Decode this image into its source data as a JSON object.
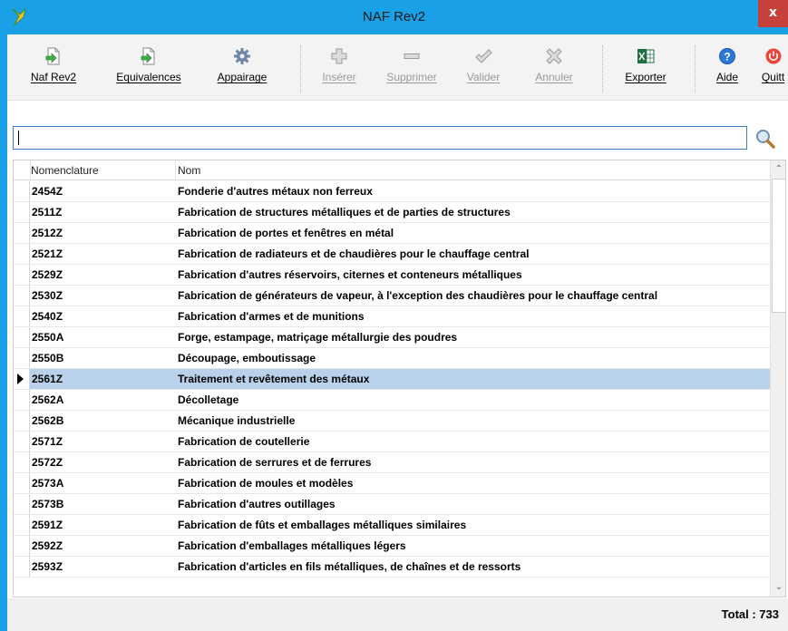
{
  "window": {
    "title": "NAF Rev2",
    "close_glyph": "x"
  },
  "icons": {
    "app": "app-logo-icon",
    "naf": "document-green-arrow-icon",
    "equivalences": "document-green-arrow-icon",
    "appairage": "gear-icon",
    "inserer": "plus-icon",
    "supprimer": "minus-icon",
    "valider": "checkmark-icon",
    "annuler": "cross-icon",
    "exporter": "excel-icon",
    "aide": "help-icon",
    "quitter": "power-icon",
    "search": "magnifier-icon"
  },
  "toolbar": {
    "naf_label": "Naf Rev2",
    "equivalences_label": "Equivalences",
    "appairage_label": "Appairage",
    "inserer_label": "Insérer",
    "supprimer_label": "Supprimer",
    "valider_label": "Valider",
    "annuler_label": "Annuler",
    "exporter_label": "Exporter",
    "aide_label": "Aide",
    "quitter_label": "Quitt"
  },
  "search": {
    "value": "",
    "placeholder": ""
  },
  "grid": {
    "columns": [
      "Nomenclature",
      "Nom"
    ],
    "selected_index": 9,
    "rows": [
      {
        "code": "2454Z",
        "nom": "Fonderie d'autres métaux non ferreux"
      },
      {
        "code": "2511Z",
        "nom": "Fabrication de structures métalliques et de parties de structures"
      },
      {
        "code": "2512Z",
        "nom": "Fabrication de portes et fenêtres en métal"
      },
      {
        "code": "2521Z",
        "nom": "Fabrication de radiateurs et de chaudières pour le chauffage central"
      },
      {
        "code": "2529Z",
        "nom": "Fabrication d'autres réservoirs, citernes et conteneurs métalliques"
      },
      {
        "code": "2530Z",
        "nom": "Fabrication de générateurs de vapeur, à l'exception des chaudières pour le chauffage central"
      },
      {
        "code": "2540Z",
        "nom": "Fabrication d'armes et de munitions"
      },
      {
        "code": "2550A",
        "nom": "Forge, estampage, matriçage  métallurgie des poudres"
      },
      {
        "code": "2550B",
        "nom": "Découpage, emboutissage"
      },
      {
        "code": "2561Z",
        "nom": "Traitement et revêtement des métaux"
      },
      {
        "code": "2562A",
        "nom": "Décolletage"
      },
      {
        "code": "2562B",
        "nom": "Mécanique industrielle"
      },
      {
        "code": "2571Z",
        "nom": "Fabrication de coutellerie"
      },
      {
        "code": "2572Z",
        "nom": "Fabrication de serrures et de ferrures"
      },
      {
        "code": "2573A",
        "nom": "Fabrication de moules et modèles"
      },
      {
        "code": "2573B",
        "nom": "Fabrication d'autres outillages"
      },
      {
        "code": "2591Z",
        "nom": "Fabrication de fûts et emballages métalliques similaires"
      },
      {
        "code": "2592Z",
        "nom": "Fabrication d'emballages métalliques légers"
      },
      {
        "code": "2593Z",
        "nom": "Fabrication d'articles en fils métalliques, de chaînes et de ressorts"
      }
    ]
  },
  "status": {
    "total_text": "Total : 733"
  },
  "colors": {
    "titlebar": "#1aa0e6",
    "selection": "#b9d1ea",
    "close": "#c7413a"
  }
}
